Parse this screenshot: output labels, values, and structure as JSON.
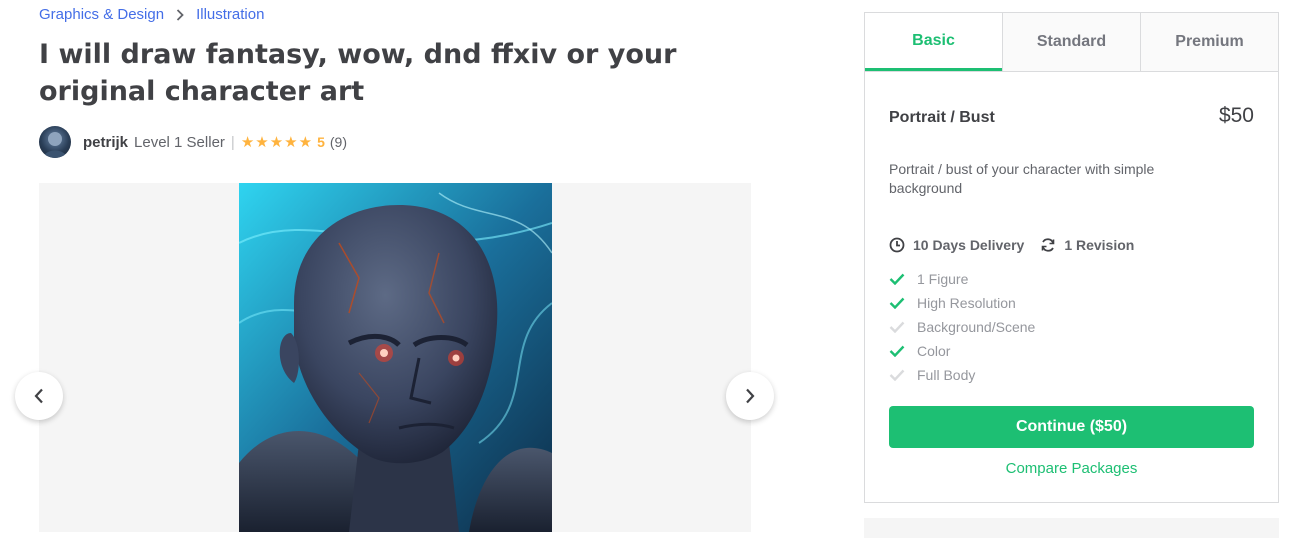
{
  "breadcrumb": {
    "items": [
      "Graphics & Design",
      "Illustration"
    ]
  },
  "gig": {
    "title": "I will draw fantasy, wow, dnd ffxiv or your original character art"
  },
  "seller": {
    "name": "petrijk",
    "level": "Level 1 Seller",
    "divider": "|",
    "rating": "5",
    "rating_value": 5,
    "reviews": "(9)"
  },
  "packages": {
    "tabs": [
      "Basic",
      "Standard",
      "Premium"
    ],
    "active_tab": "Basic",
    "name": "Portrait / Bust",
    "price": "$50",
    "description": "Portrait / bust of your character with simple background",
    "delivery": "10 Days Delivery",
    "revisions": "1 Revision",
    "features": [
      {
        "label": "1 Figure",
        "included": true
      },
      {
        "label": "High Resolution",
        "included": true
      },
      {
        "label": "Background/Scene",
        "included": false
      },
      {
        "label": "Color",
        "included": true
      },
      {
        "label": "Full Body",
        "included": false
      }
    ],
    "cta_label": "Continue ($50)",
    "compare_label": "Compare Packages"
  },
  "colors": {
    "accent": "#1dbf73",
    "link": "#446ee7",
    "star": "#ffb33e"
  },
  "icons": {
    "breadcrumb_separator": "chevron-right-icon",
    "prev": "chevron-left-icon",
    "next": "chevron-right-icon",
    "delivery": "clock-icon",
    "revision": "refresh-icon",
    "feature": "check-icon"
  }
}
